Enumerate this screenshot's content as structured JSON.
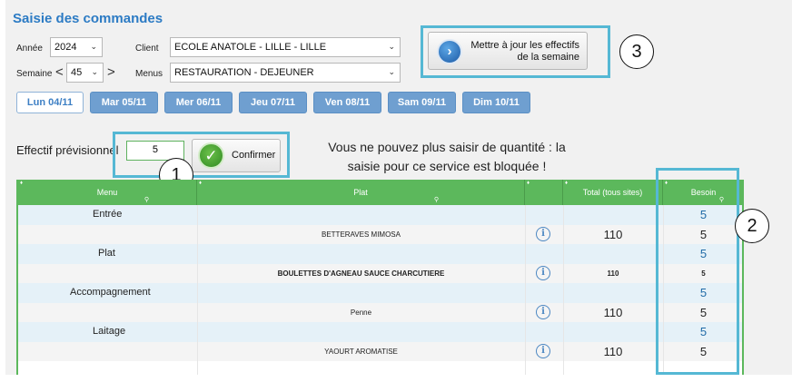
{
  "page": {
    "title": "Saisie des commandes"
  },
  "filters": {
    "annee_label": "Année",
    "annee_value": "2024",
    "semaine_label": "Semaine",
    "semaine_value": "45",
    "semaine_prev": "<",
    "semaine_next": ">",
    "client_label": "Client",
    "client_value": "ECOLE ANATOLE - LILLE - LILLE",
    "menus_label": "Menus",
    "menus_value": "RESTAURATION - DEJEUNER"
  },
  "update_button": {
    "line1": "Mettre à jour les effectifs",
    "line2": "de la semaine",
    "icon": "arrow-right-circle-icon"
  },
  "days": [
    {
      "label": "Lun 04/11",
      "active": true
    },
    {
      "label": "Mar 05/11",
      "active": false
    },
    {
      "label": "Mer 06/11",
      "active": false
    },
    {
      "label": "Jeu 07/11",
      "active": false
    },
    {
      "label": "Ven 08/11",
      "active": false
    },
    {
      "label": "Sam 09/11",
      "active": false
    },
    {
      "label": "Dim 10/11",
      "active": false
    }
  ],
  "effectif": {
    "label": "Effectif prévisionnel",
    "value": "5",
    "confirm_label": "Confirmer"
  },
  "message": {
    "line1": "Vous ne pouvez plus saisir de quantité : la",
    "line2": "saisie pour ce service est bloquée !"
  },
  "annotations": {
    "one": "1",
    "two": "2",
    "three": "3"
  },
  "table": {
    "columns": {
      "menu": "Menu",
      "plat": "Plat",
      "total": "Total (tous sites)",
      "besoin": "Besoin"
    },
    "rows": [
      {
        "type": "category",
        "menu": "Entrée",
        "besoin": "5"
      },
      {
        "type": "plat",
        "plat": "BETTERAVES MIMOSA",
        "total": "110",
        "besoin": "5"
      },
      {
        "type": "category",
        "menu": "Plat",
        "besoin": "5"
      },
      {
        "type": "plat",
        "plat": "BOULETTES D'AGNEAU SAUCE CHARCUTIERE",
        "total": "110",
        "besoin": "5"
      },
      {
        "type": "category",
        "menu": "Accompagnement",
        "besoin": "5"
      },
      {
        "type": "plat",
        "plat": "Penne",
        "total": "110",
        "besoin": "5"
      },
      {
        "type": "category",
        "menu": "Laitage",
        "besoin": "5"
      },
      {
        "type": "plat",
        "plat": "YAOURT AROMATISE",
        "total": "110",
        "besoin": "5"
      }
    ]
  },
  "colors": {
    "title": "#2c7bc4",
    "day_button": "#6f9fd0",
    "grid_header": "#5cb85c",
    "highlight": "#55b8d4"
  }
}
